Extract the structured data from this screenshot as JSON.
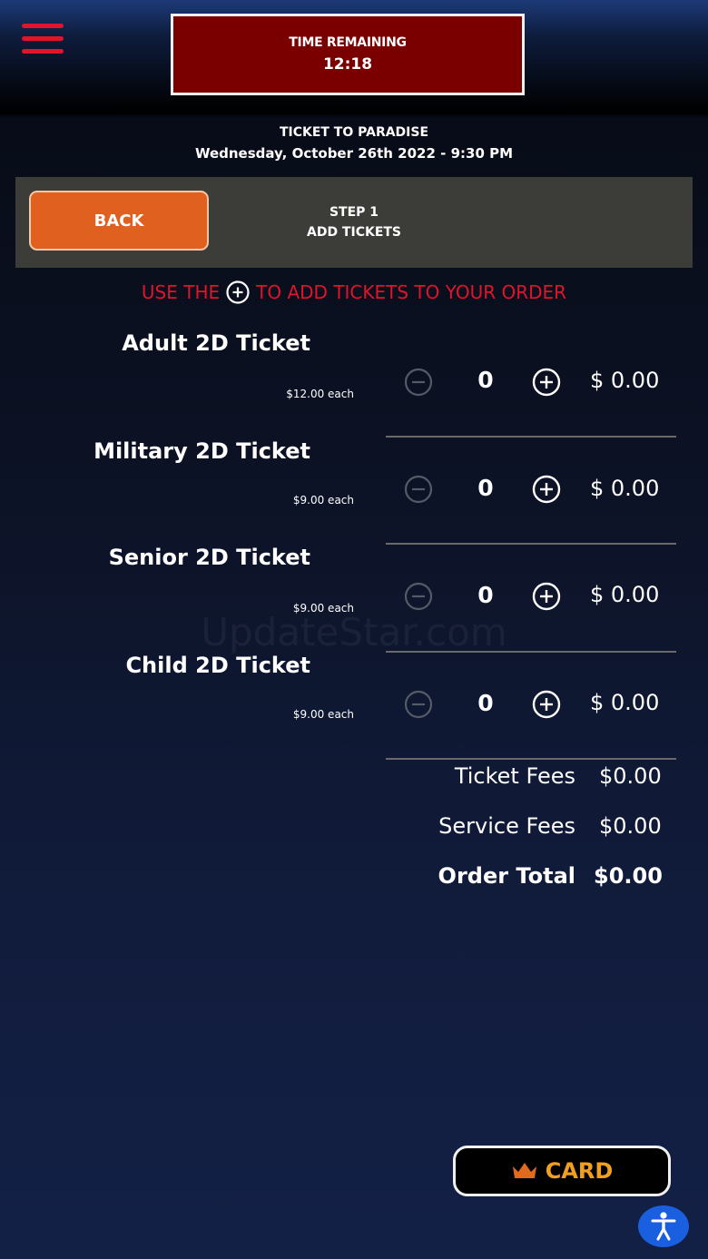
{
  "header": {
    "timer_label": "TIME REMAINING",
    "timer_value": "12:18",
    "movie_title": "TICKET TO PARADISE",
    "showtime": "Wednesday, October 26th 2022 - 9:30 PM"
  },
  "step_bar": {
    "back_label": "BACK",
    "step_number": "STEP 1",
    "step_title": "ADD TICKETS"
  },
  "instruction": {
    "before": "USE THE",
    "after": "TO ADD TICKETS TO YOUR ORDER",
    "icon": "plus-circle-icon"
  },
  "tickets": [
    {
      "name": "Adult 2D Ticket",
      "price": "$12.00 each",
      "qty": "0",
      "total": "$ 0.00"
    },
    {
      "name": "Military 2D Ticket",
      "price": "$9.00 each",
      "qty": "0",
      "total": "$ 0.00"
    },
    {
      "name": "Senior 2D Ticket",
      "price": "$9.00 each",
      "qty": "0",
      "total": "$ 0.00"
    },
    {
      "name": "Child 2D Ticket",
      "price": "$9.00 each",
      "qty": "0",
      "total": "$ 0.00"
    }
  ],
  "summary": {
    "ticket_fees_label": "Ticket Fees",
    "ticket_fees_value": "$0.00",
    "service_fees_label": "Service Fees",
    "service_fees_value": "$0.00",
    "order_total_label": "Order Total",
    "order_total_value": "$0.00"
  },
  "card_button": {
    "label": "CARD",
    "icon": "crown-icon"
  },
  "watermark": "UpdateStar.com",
  "colors": {
    "accent_red": "#e0142a",
    "timer_bg": "#7a0000",
    "back_orange": "#e0601f",
    "card_gold": "#f0a020",
    "a11y_blue": "#1a5fe0"
  }
}
